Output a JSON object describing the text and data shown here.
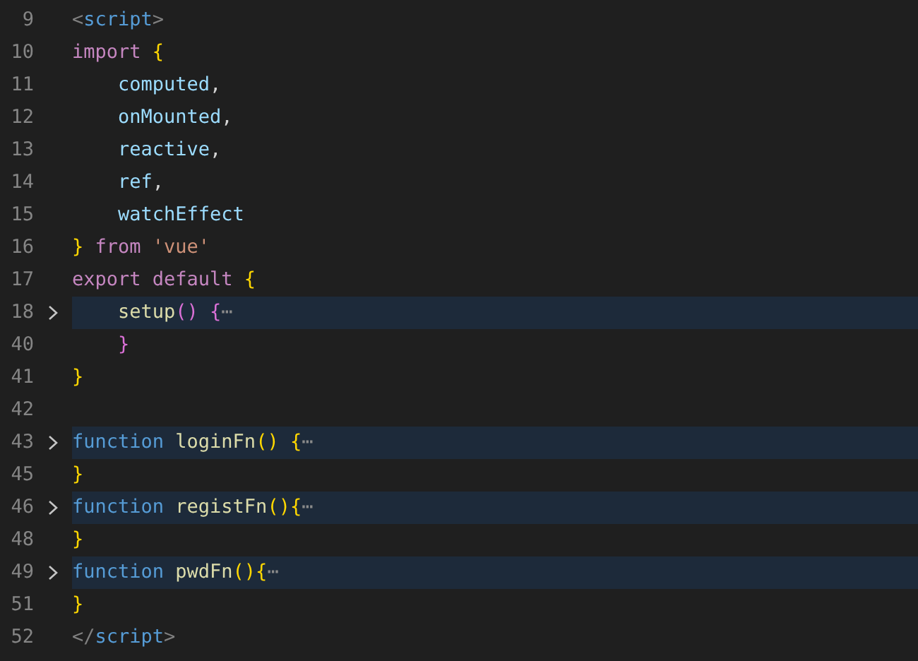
{
  "editor": {
    "lines": [
      {
        "number": "9",
        "folded": false,
        "tokens": [
          {
            "kind": "tag-bracket",
            "text": "<"
          },
          {
            "kind": "tag",
            "text": "script"
          },
          {
            "kind": "tag-bracket",
            "text": ">"
          }
        ]
      },
      {
        "number": "10",
        "folded": false,
        "tokens": [
          {
            "kind": "keyword",
            "text": "import "
          },
          {
            "kind": "bracket",
            "text": "{"
          }
        ]
      },
      {
        "number": "11",
        "folded": false,
        "tokens": [
          {
            "kind": "variable",
            "text": "    computed"
          },
          {
            "kind": "plain",
            "text": ","
          }
        ]
      },
      {
        "number": "12",
        "folded": false,
        "tokens": [
          {
            "kind": "variable",
            "text": "    onMounted"
          },
          {
            "kind": "plain",
            "text": ","
          }
        ]
      },
      {
        "number": "13",
        "folded": false,
        "tokens": [
          {
            "kind": "variable",
            "text": "    reactive"
          },
          {
            "kind": "plain",
            "text": ","
          }
        ]
      },
      {
        "number": "14",
        "folded": false,
        "tokens": [
          {
            "kind": "variable",
            "text": "    ref"
          },
          {
            "kind": "plain",
            "text": ","
          }
        ]
      },
      {
        "number": "15",
        "folded": false,
        "tokens": [
          {
            "kind": "variable",
            "text": "    watchEffect"
          }
        ]
      },
      {
        "number": "16",
        "folded": false,
        "tokens": [
          {
            "kind": "bracket",
            "text": "} "
          },
          {
            "kind": "keyword",
            "text": "from "
          },
          {
            "kind": "string",
            "text": "'vue'"
          }
        ]
      },
      {
        "number": "17",
        "folded": false,
        "tokens": [
          {
            "kind": "keyword",
            "text": "export default "
          },
          {
            "kind": "bracket",
            "text": "{"
          }
        ]
      },
      {
        "number": "18",
        "folded": true,
        "tokens": [
          {
            "kind": "function",
            "text": "    setup"
          },
          {
            "kind": "bracket-2",
            "text": "() {"
          },
          {
            "kind": "fold",
            "text": "⋯"
          }
        ]
      },
      {
        "number": "40",
        "folded": false,
        "tokens": [
          {
            "kind": "bracket-2",
            "text": "    }"
          }
        ]
      },
      {
        "number": "41",
        "folded": false,
        "tokens": [
          {
            "kind": "bracket",
            "text": "}"
          }
        ]
      },
      {
        "number": "42",
        "folded": false
      },
      {
        "number": "43",
        "folded": true,
        "tokens": [
          {
            "kind": "storage",
            "text": "function "
          },
          {
            "kind": "function",
            "text": "loginFn"
          },
          {
            "kind": "bracket",
            "text": "() {"
          },
          {
            "kind": "fold",
            "text": "⋯"
          }
        ]
      },
      {
        "number": "45",
        "folded": false,
        "tokens": [
          {
            "kind": "bracket",
            "text": "}"
          }
        ]
      },
      {
        "number": "46",
        "folded": true,
        "tokens": [
          {
            "kind": "storage",
            "text": "function "
          },
          {
            "kind": "function",
            "text": "registFn"
          },
          {
            "kind": "bracket",
            "text": "(){"
          },
          {
            "kind": "fold",
            "text": "⋯"
          }
        ]
      },
      {
        "number": "48",
        "folded": false,
        "tokens": [
          {
            "kind": "bracket",
            "text": "}"
          }
        ]
      },
      {
        "number": "49",
        "folded": true,
        "tokens": [
          {
            "kind": "storage",
            "text": "function "
          },
          {
            "kind": "function",
            "text": "pwdFn"
          },
          {
            "kind": "bracket",
            "text": "(){"
          },
          {
            "kind": "fold",
            "text": "⋯"
          }
        ]
      },
      {
        "number": "51",
        "folded": false,
        "tokens": [
          {
            "kind": "bracket",
            "text": "}"
          }
        ]
      },
      {
        "number": "52",
        "folded": false,
        "tokens": [
          {
            "kind": "tag-bracket",
            "text": "</"
          },
          {
            "kind": "tag",
            "text": "script"
          },
          {
            "kind": "tag-bracket",
            "text": ">"
          }
        ]
      }
    ]
  }
}
